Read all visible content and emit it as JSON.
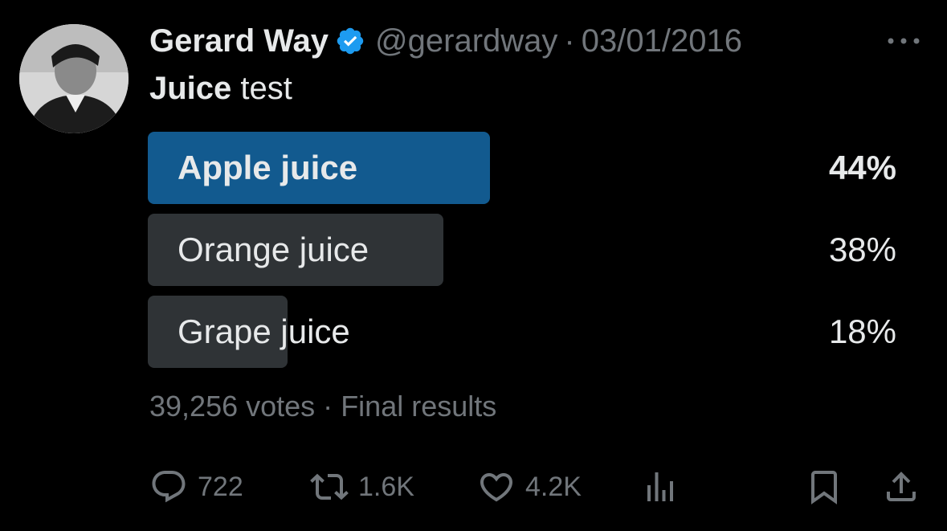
{
  "tweet": {
    "author_name": "Gerard Way",
    "handle": "@gerardway",
    "separator": "·",
    "date": "03/01/2016",
    "text_bold": "Juice",
    "text_rest": " test"
  },
  "poll": {
    "options": [
      {
        "label": "Apple juice",
        "percent_text": "44%",
        "percent": 44,
        "winner": true
      },
      {
        "label": "Orange juice",
        "percent_text": "38%",
        "percent": 38,
        "winner": false
      },
      {
        "label": "Grape juice",
        "percent_text": "18%",
        "percent": 18,
        "winner": false
      }
    ],
    "votes": "39,256 votes",
    "separator": "·",
    "status": "Final results"
  },
  "actions": {
    "replies": "722",
    "retweets": "1.6K",
    "likes": "4.2K"
  },
  "colors": {
    "background": "#000000",
    "winner_bar": "#125a8f",
    "loser_bar": "#2f3336",
    "muted_text": "#71767b",
    "verified_badge": "#1d9bf0"
  },
  "icons": {
    "verified": "verified-badge-icon",
    "more": "more-options-icon",
    "reply": "reply-icon",
    "retweet": "retweet-icon",
    "like": "heart-icon",
    "views": "analytics-icon",
    "bookmark": "bookmark-icon",
    "share": "share-icon"
  }
}
